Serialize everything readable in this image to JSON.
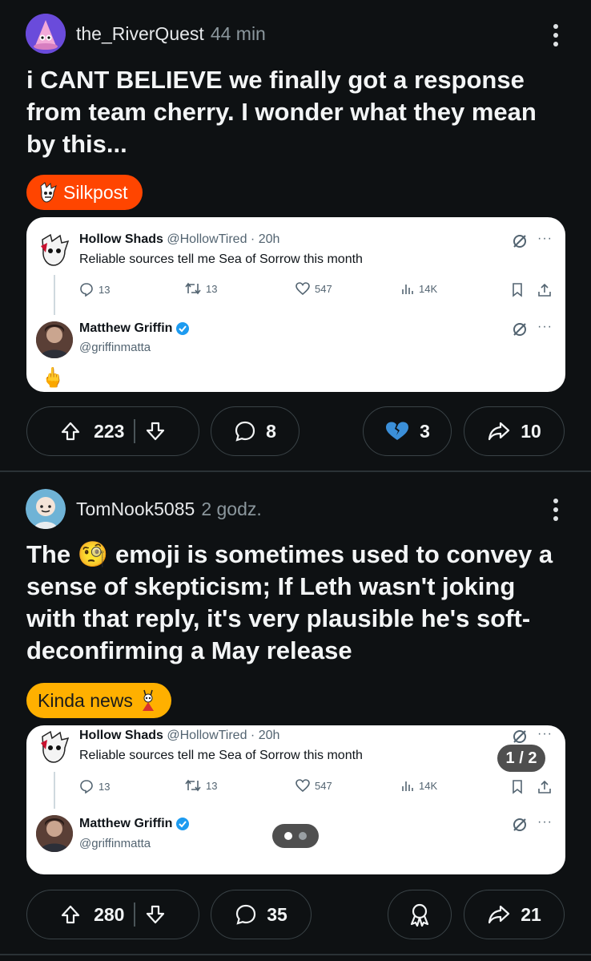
{
  "post1": {
    "username": "the_RiverQuest",
    "time": "44 min",
    "title": "i CANT BELIEVE we finally got a response from team cherry. I wonder what they mean by this...",
    "flair": "Silkpost",
    "embed": {
      "tweet1": {
        "name": "Hollow Shads",
        "handle": "@HollowTired · 20h",
        "text": "Reliable sources tell me Sea of Sorrow this month",
        "replies": "13",
        "retweets": "13",
        "likes": "547",
        "views": "14K"
      },
      "tweet2": {
        "name": "Matthew Griffin",
        "handle": "@griffinmatta",
        "reply": "🖕"
      }
    },
    "upvotes": "223",
    "comments": "8",
    "awards": "3",
    "shares": "10"
  },
  "post2": {
    "username": "TomNook5085",
    "time": "2 godz.",
    "title_pre": "The ",
    "title_emoji": "🧐",
    "title_post": " emoji is sometimes used to convey a sense of skepticism; If Leth wasn't joking with that reply, it's very plausible he's soft-deconfirming a May release",
    "flair": "Kinda news",
    "gallery_counter": "1 / 2",
    "embed": {
      "tweet1": {
        "name": "Hollow Shads",
        "handle": "@HollowTired · 20h",
        "text": "Reliable sources tell me Sea of Sorrow this month",
        "replies": "13",
        "retweets": "13",
        "likes": "547",
        "views": "14K"
      },
      "tweet2": {
        "name": "Matthew Griffin",
        "handle": "@griffinmatta"
      }
    },
    "upvotes": "280",
    "comments": "35",
    "shares": "21"
  },
  "colors": {
    "background": "#0e1113",
    "flair_silkpost": "#ff4500",
    "flair_kinda_news": "#ffb000",
    "verified": "#1d9bf0",
    "pill_border": "#3a4347"
  },
  "icons": [
    "kebab-menu-icon",
    "upvote-icon",
    "downvote-icon",
    "comment-icon",
    "broken-heart-award-icon",
    "award-icon",
    "share-icon",
    "verified-icon",
    "reply-icon",
    "retweet-icon",
    "like-icon",
    "views-icon",
    "bookmark-icon",
    "upload-icon",
    "grok-icon",
    "more-icon"
  ]
}
